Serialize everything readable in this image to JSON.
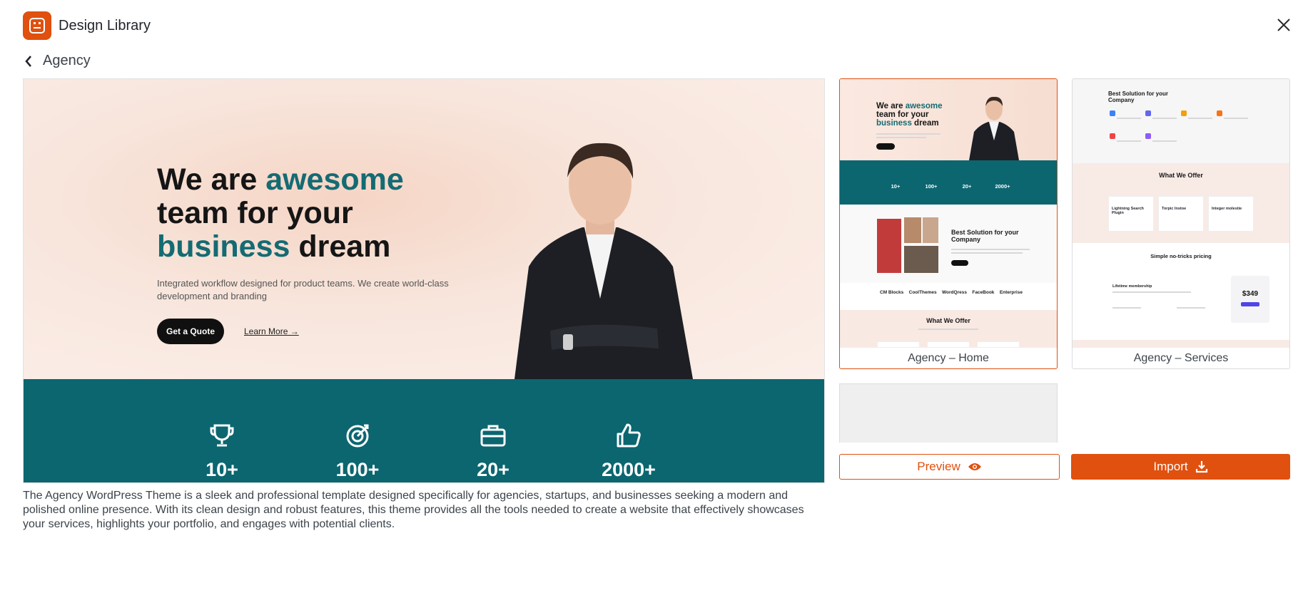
{
  "app": {
    "title": "Design Library",
    "close_icon": "close-icon"
  },
  "breadcrumb": {
    "back_label": "Agency"
  },
  "preview": {
    "hero": {
      "title_part1": "We are ",
      "title_accent1": "awesome",
      "title_part2": "team for your",
      "title_accent2": "business",
      "title_part3": " dream",
      "subtitle": "Integrated workflow designed for product teams. We create world-class development and branding",
      "primary_button": "Get a Quote",
      "secondary_link": "Learn More →"
    },
    "stats": [
      {
        "icon": "trophy-icon",
        "value": "10+"
      },
      {
        "icon": "target-icon",
        "value": "100+"
      },
      {
        "icon": "briefcase-icon",
        "value": "20+"
      },
      {
        "icon": "thumbs-up-icon",
        "value": "2000+"
      }
    ]
  },
  "description": "The Agency WordPress Theme is a sleek and professional template designed specifically for agencies, startups, and businesses seeking a modern and polished online presence. With its clean design and robust features, this theme provides all the tools needed to create a website that effectively showcases your services, highlights your portfolio, and engages with potential clients.",
  "templates": [
    {
      "caption": "Agency – Home",
      "mini": {
        "title_part1": "We are ",
        "title_accent1": "awesome",
        "title_part2": "team for your",
        "title_accent2": "business",
        "title_part3": " dream",
        "stats": [
          "10+",
          "100+",
          "20+",
          "2000+"
        ],
        "section_title": "Best Solution for your Company",
        "logos": [
          "CM Blocks",
          "CoolThemes",
          "WordQress",
          "FaceBook",
          "Enterprise"
        ],
        "offer_title": "What We Offer"
      }
    },
    {
      "caption": "Agency – Services",
      "mini": {
        "section_title": "Best Solution for your Company",
        "offer_title": "What We Offer",
        "cards": [
          "Lightning Search Plugin",
          "Torpic Instoe",
          "Integer molestie"
        ],
        "pricing_title": "Simple no-tricks pricing",
        "plan_name": "Lifetime membership",
        "price": "$349"
      }
    }
  ],
  "actions": {
    "preview_label": "Preview",
    "import_label": "Import"
  },
  "colors": {
    "brand": "#e0500f",
    "teal": "#0b6670",
    "accent_text": "#146b73"
  }
}
